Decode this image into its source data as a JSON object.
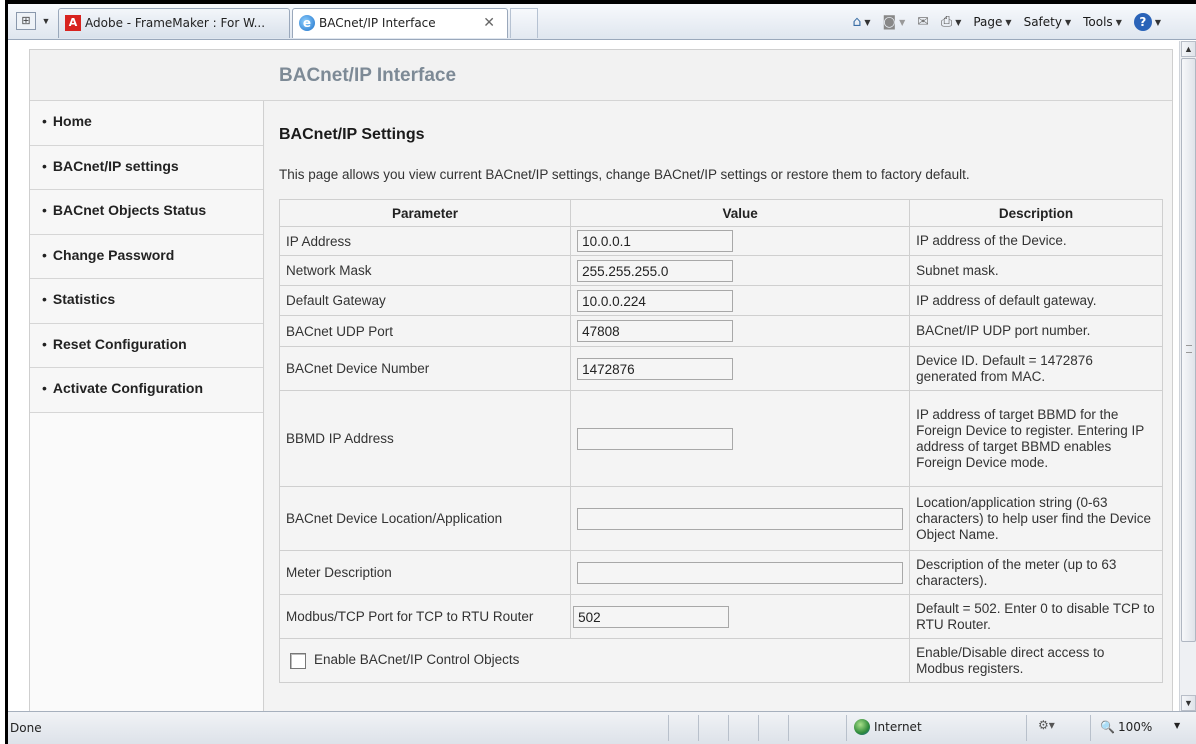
{
  "browser": {
    "tabs": [
      {
        "label": "Adobe - FrameMaker : For W..."
      },
      {
        "label": "BACnet/IP Interface"
      }
    ],
    "tab_close": "✕",
    "commands": {
      "page": "Page",
      "safety": "Safety",
      "tools": "Tools"
    },
    "status": {
      "text": "Done",
      "zone": "Internet",
      "zoom": "100%"
    }
  },
  "page": {
    "title": "BACnet/IP Interface",
    "nav": [
      {
        "label": "Home"
      },
      {
        "label": "BACnet/IP settings"
      },
      {
        "label": "BACnet Objects Status"
      },
      {
        "label": "Change Password"
      },
      {
        "label": "Statistics"
      },
      {
        "label": "Reset Configuration"
      },
      {
        "label": "Activate Configuration"
      }
    ],
    "section_title": "BACnet/IP Settings",
    "intro": "This page allows you view current BACnet/IP settings, change BACnet/IP settings or restore them to factory default.",
    "table": {
      "headers": [
        "Parameter",
        "Value",
        "Description"
      ],
      "rows": [
        {
          "param": "IP Address",
          "value": "10.0.0.1",
          "desc": "IP address of the Device."
        },
        {
          "param": "Network Mask",
          "value": "255.255.255.0",
          "desc": "Subnet mask."
        },
        {
          "param": "Default Gateway",
          "value": "10.0.0.224",
          "desc": "IP address of default gateway."
        },
        {
          "param": "BACnet UDP Port",
          "value": "47808",
          "desc": "BACnet/IP UDP port number."
        },
        {
          "param": "BACnet Device Number",
          "value": "1472876",
          "desc": "Device ID. Default = 1472876 generated from MAC."
        },
        {
          "param": "BBMD IP Address",
          "value": "",
          "desc": "IP address of target BBMD for the Foreign Device to register. Entering IP address of target BBMD enables Foreign Device mode."
        },
        {
          "param": "BACnet Device Location/Application",
          "value": "",
          "desc": "Location/application string (0-63 characters) to help user find the Device Object Name."
        },
        {
          "param": "Meter Description",
          "value": "",
          "desc": "Description of the meter (up to 63 characters)."
        },
        {
          "param": "Modbus/TCP Port for TCP to RTU Router",
          "value": "502",
          "desc": "Default = 502. Enter 0 to disable TCP to RTU Router."
        }
      ],
      "checkbox_row": {
        "label": "Enable BACnet/IP Control Objects",
        "checked": false,
        "desc": "Enable/Disable direct access to Modbus registers."
      }
    }
  }
}
